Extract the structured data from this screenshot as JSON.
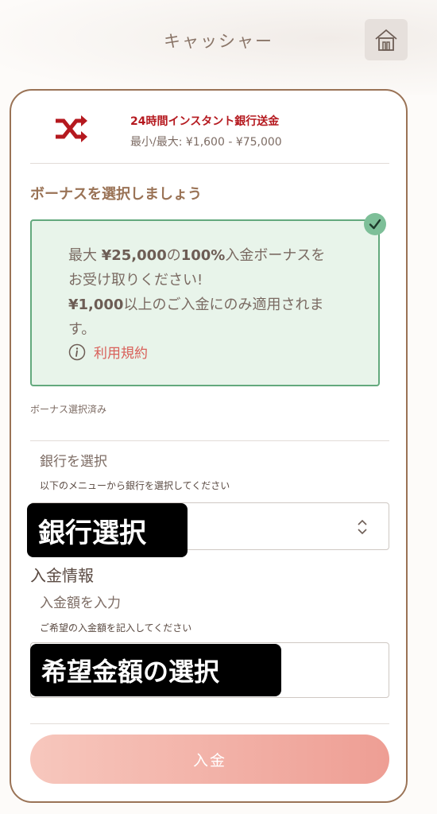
{
  "header": {
    "title": "キャッシャー",
    "home_icon": "home-icon"
  },
  "payment_method": {
    "icon": "shuffle-icon",
    "title": "24時間インスタント銀行送金",
    "limits": "最小/最大: ¥1,600 - ¥75,000"
  },
  "bonus": {
    "heading": "ボーナスを選択しましょう",
    "line1_prefix": "最大 ",
    "line1_amount": "¥25,000",
    "line1_mid": "の",
    "line1_percent": "100%",
    "line1_suffix": "入金ボーナスを",
    "line2": "お受け取りください!",
    "line3_amount": "¥1,000",
    "line3_suffix": "以上のご入金にのみ適用されま",
    "line4": "す。",
    "terms_label": "利用規約",
    "selected": true,
    "status": "ボーナス選択済み"
  },
  "bank": {
    "label": "銀行を選択",
    "help": "以下のメニューから銀行を選択してください",
    "value": ""
  },
  "deposit_info": {
    "heading": "入金情報",
    "amount_label": "入金額を入力",
    "amount_help": "ご希望の入金額を記入してください",
    "amount_value": ""
  },
  "annotations": {
    "bank_select": "銀行選択",
    "amount_select": "希望金額の選択"
  },
  "submit": {
    "label": "入金"
  },
  "colors": {
    "accent_brown": "#9a7356",
    "bonus_green": "#63a97d",
    "brand_red": "#b5191f",
    "button_pink": "#ee9e94"
  }
}
